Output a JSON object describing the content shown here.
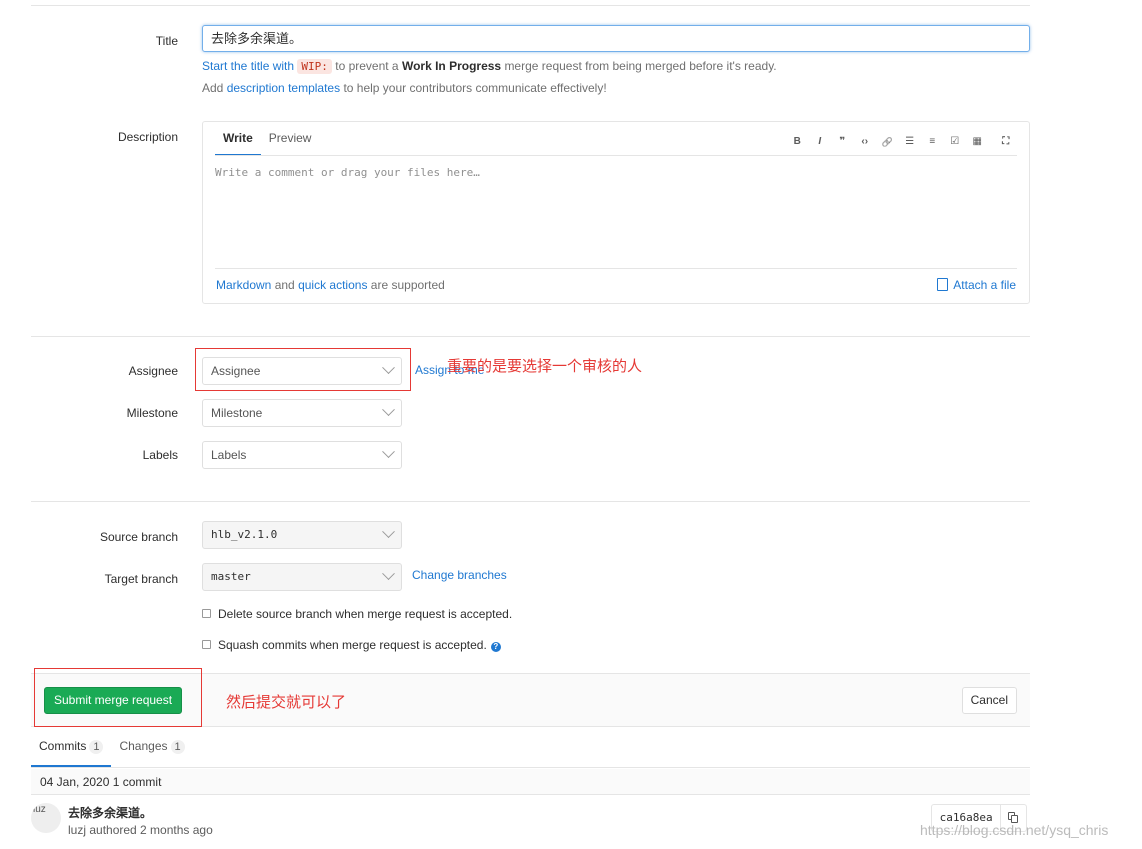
{
  "form": {
    "title_label": "Title",
    "title_value": "去除多余渠道。",
    "wip_hint": {
      "pre": "Start the title with",
      "code": "WIP:",
      "mid": "to prevent a",
      "bold": "Work In Progress",
      "post": "merge request from being merged before it's ready."
    },
    "template_hint": {
      "pre": "Add",
      "link": "description templates",
      "post": "to help your contributors communicate effectively!"
    },
    "description_label": "Description",
    "tabs": {
      "write": "Write",
      "preview": "Preview"
    },
    "toolbar": [
      "B",
      "I",
      "❞",
      "‹›",
      "🔗",
      "☰",
      "≡",
      "☑",
      "▦",
      "⛶"
    ],
    "toolbar_icons": [
      "bold-icon",
      "italic-icon",
      "quote-icon",
      "code-icon",
      "link-icon",
      "bullet-list-icon",
      "numbered-list-icon",
      "task-list-icon",
      "table-icon",
      "fullscreen-icon"
    ],
    "description_placeholder": "Write a comment or drag your files here…",
    "markdown_footer": {
      "link1": "Markdown",
      "and": "and",
      "link2": "quick actions",
      "post": "are supported"
    },
    "attach_label": "Attach a file",
    "assignee_label": "Assignee",
    "assignee_placeholder": "Assignee",
    "assign_to_me": "Assign to me",
    "milestone_label": "Milestone",
    "milestone_placeholder": "Milestone",
    "labels_label": "Labels",
    "labels_placeholder": "Labels",
    "source_branch_label": "Source branch",
    "source_branch_value": "hlb_v2.1.0",
    "target_branch_label": "Target branch",
    "target_branch_value": "master",
    "change_branches": "Change branches",
    "delete_source_label": "Delete source branch when merge request is accepted.",
    "squash_label": "Squash commits when merge request is accepted.",
    "submit_label": "Submit merge request",
    "cancel_label": "Cancel"
  },
  "annotations": {
    "assignee_note": "重要的是要选择一个审核的人",
    "submit_note": "然后提交就可以了",
    "color": "#e53935"
  },
  "commits": {
    "tabs": [
      {
        "label": "Commits",
        "count": "1"
      },
      {
        "label": "Changes",
        "count": "1"
      }
    ],
    "day_header": "04 Jan, 2020 1 commit",
    "items": [
      {
        "avatar_alt": "luz",
        "title": "去除多余渠道。",
        "meta": "luzj authored 2 months ago",
        "sha": "ca16a8ea"
      }
    ]
  },
  "watermark": "https://blog.csdn.net/ysq_chris",
  "colors": {
    "accent": "#1f78d1",
    "submit": "#1aaa55"
  }
}
